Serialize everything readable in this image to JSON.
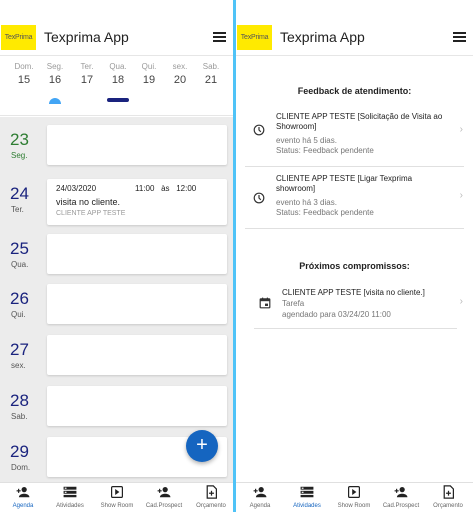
{
  "app": {
    "logo_text": "TexPrima",
    "title": "Texprima App"
  },
  "week": {
    "days": [
      {
        "name": "Dom.",
        "date": "15"
      },
      {
        "name": "Seg.",
        "date": "16"
      },
      {
        "name": "Ter.",
        "date": "17"
      },
      {
        "name": "Qua.",
        "date": "18"
      },
      {
        "name": "Qui.",
        "date": "19"
      },
      {
        "name": "sex.",
        "date": "20"
      },
      {
        "name": "Sab.",
        "date": "21"
      }
    ],
    "today_color": "#42a5f5",
    "selected_color": "#1a237e"
  },
  "agenda": {
    "rows": [
      {
        "day": "23",
        "weekday": "Seg."
      },
      {
        "day": "24",
        "weekday": "Ter."
      },
      {
        "day": "25",
        "weekday": "Qua."
      },
      {
        "day": "26",
        "weekday": "Qui."
      },
      {
        "day": "27",
        "weekday": "sex."
      },
      {
        "day": "28",
        "weekday": "Sab."
      },
      {
        "day": "29",
        "weekday": "Dom."
      }
    ],
    "event": {
      "date": "24/03/2020",
      "start": "11:00",
      "sep": "às",
      "end": "12:00",
      "title": "visita no cliente.",
      "client": "CLIENTE APP TESTE"
    },
    "fab_label": "+"
  },
  "nav": {
    "items": [
      {
        "label": "Agenda",
        "icon": "person-add-icon"
      },
      {
        "label": "Atividades",
        "icon": "list-icon"
      },
      {
        "label": "Show Room",
        "icon": "play-box-icon"
      },
      {
        "label": "Cad.Prospect",
        "icon": "person-add-icon"
      },
      {
        "label": "Orçamento",
        "icon": "document-add-icon"
      }
    ],
    "left_active": 0,
    "right_active": 1,
    "active_color": "#1565c0"
  },
  "activities": {
    "feedback_title": "Feedback de atendimento:",
    "feedback": [
      {
        "title": "CLIENTE APP TESTE [Solicitação de Visita ao Showroom]",
        "line1": "evento há 5 dias.",
        "line2": "Status: Feedback pendente"
      },
      {
        "title": "CLIENTE APP TESTE [Ligar Texprima showroom]",
        "line1": "evento há 3 dias.",
        "line2": "Status: Feedback pendente"
      }
    ],
    "upcoming_title": "Próximos compromissos:",
    "upcoming": [
      {
        "title": "CLIENTE APP TESTE [visita no cliente.]",
        "line1": "Tarefa",
        "line2": "agendado para 03/24/20 11:00"
      }
    ]
  }
}
